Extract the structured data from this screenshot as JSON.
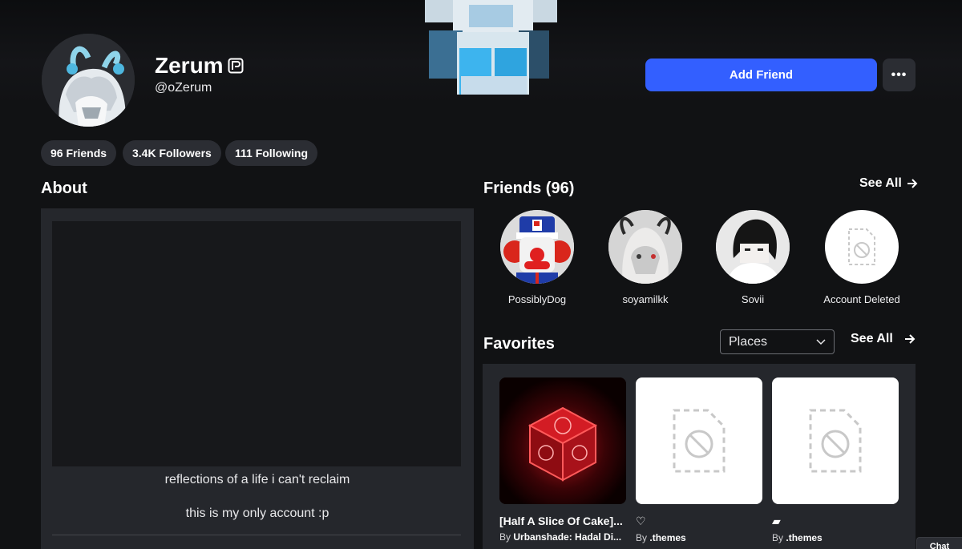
{
  "profile": {
    "display_name": "Zerum",
    "username": "@oZerum"
  },
  "actions": {
    "add_friend_label": "Add Friend",
    "more_label": "•••"
  },
  "stats": [
    {
      "label": "96 Friends"
    },
    {
      "label": "3.4K Followers"
    },
    {
      "label": "111 Following"
    }
  ],
  "about": {
    "title": "About",
    "lines": [
      "reflections of a life i can't reclaim",
      "this is my only account :p"
    ]
  },
  "friends": {
    "title": "Friends (96)",
    "see_all": "See All",
    "items": [
      {
        "name": "PossiblyDog"
      },
      {
        "name": "soyamilkk"
      },
      {
        "name": "Sovii"
      },
      {
        "name": "Account Deleted"
      }
    ]
  },
  "favorites": {
    "title": "Favorites",
    "filter_selected": "Places",
    "see_all": "See All",
    "by_label": "By",
    "items": [
      {
        "title": "[Half A Slice Of Cake]...",
        "creator": "Urbanshade: Hadal Di..."
      },
      {
        "title": "♡",
        "creator": ".themes"
      },
      {
        "title": "▰",
        "creator": ".themes"
      }
    ]
  },
  "chat": {
    "label": "Chat"
  },
  "colors": {
    "background": "#111214",
    "panel": "#25272c",
    "pill": "#2b2d33",
    "accent": "#335fff"
  }
}
